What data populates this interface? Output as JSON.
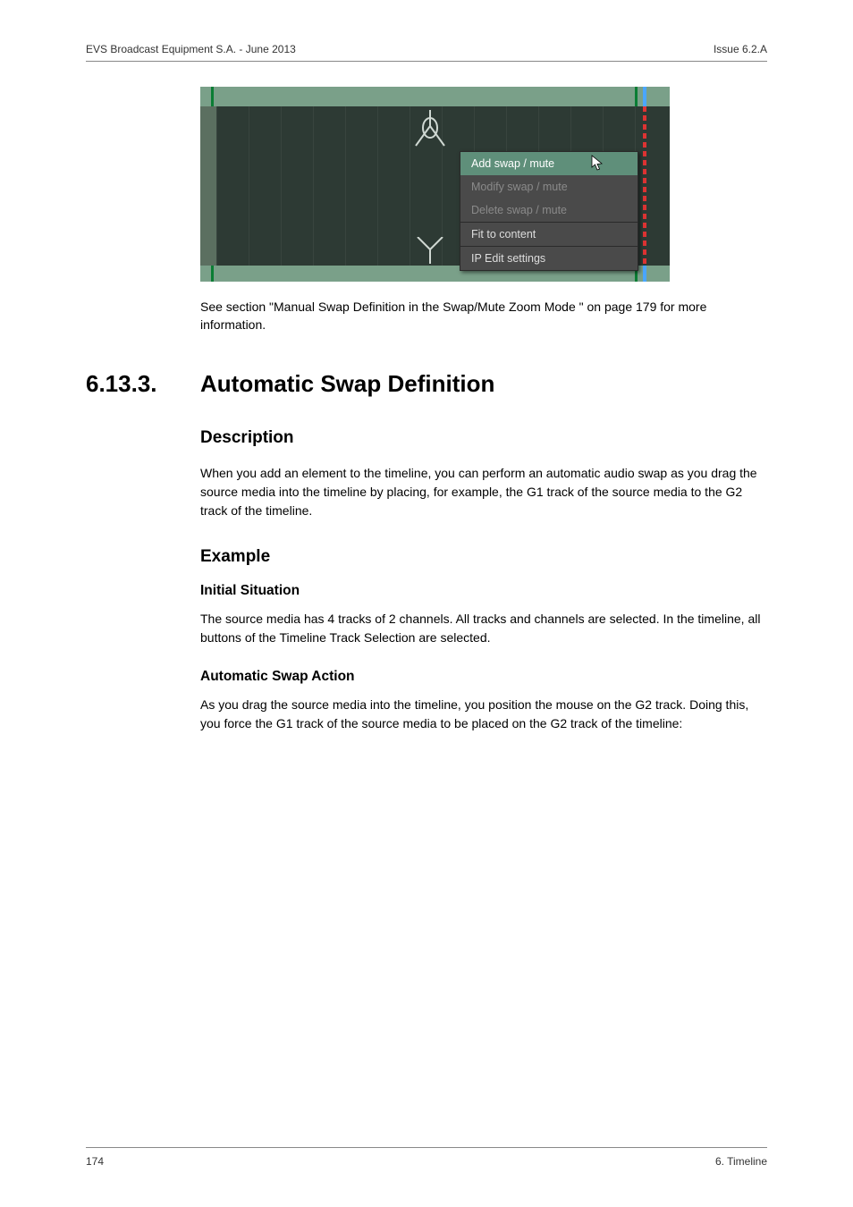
{
  "header": {
    "left": "EVS Broadcast Equipment S.A. - June 2013",
    "right": "Issue 6.2.A"
  },
  "screenshot": {
    "menu": {
      "item1": "Add swap / mute",
      "item2": "Modify swap / mute",
      "item3": "Delete swap / mute",
      "item4": "Fit to content",
      "item5": "IP Edit settings"
    }
  },
  "caption": "See section \"Manual Swap Definition in the Swap/Mute Zoom Mode \" on page 179 for more information.",
  "section": {
    "number": "6.13.3.",
    "title": "Automatic Swap Definition"
  },
  "description": {
    "heading": "Description",
    "body": "When you add an element to the timeline, you can perform an automatic audio swap as you drag the source media into the timeline by placing, for example, the G1 track of the source media to the G2 track of the timeline."
  },
  "example": {
    "heading": "Example",
    "initial": {
      "heading": "Initial Situation",
      "body": "The source media has 4 tracks of 2 channels. All tracks and channels are selected. In the timeline, all buttons of the Timeline Track Selection are selected."
    },
    "swapAction": {
      "heading": "Automatic Swap Action",
      "body": "As you drag the source media into the timeline, you position the mouse on the G2 track. Doing this, you force the G1 track of the source media to be placed on the G2 track of the timeline:"
    }
  },
  "footer": {
    "left": "174",
    "right": "6. Timeline"
  }
}
